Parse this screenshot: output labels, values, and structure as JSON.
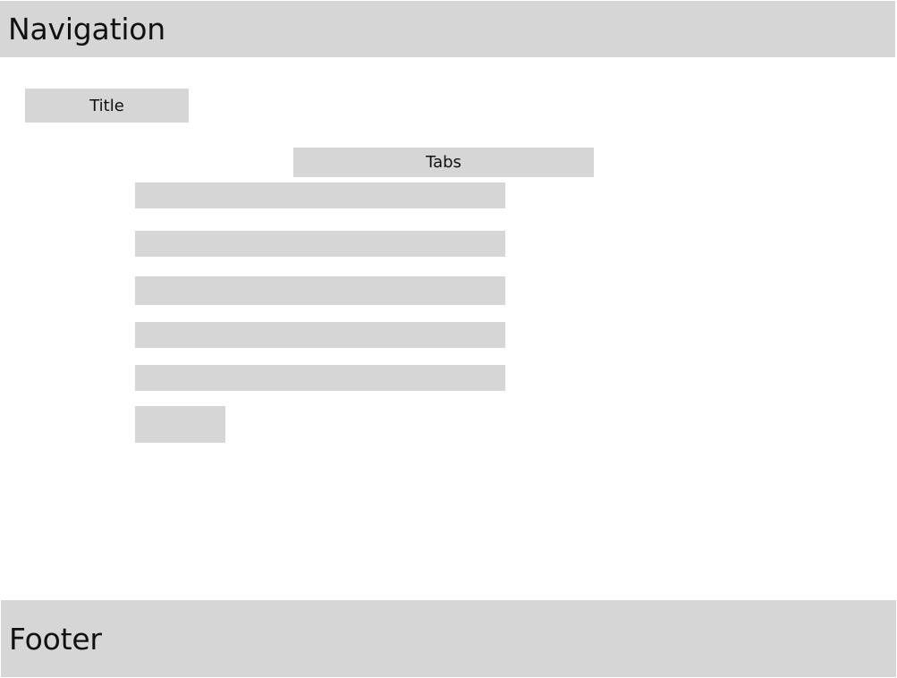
{
  "navigation": {
    "label": "Navigation"
  },
  "title": {
    "label": "Title"
  },
  "tabs": {
    "label": "Tabs"
  },
  "footer": {
    "label": "Footer"
  }
}
